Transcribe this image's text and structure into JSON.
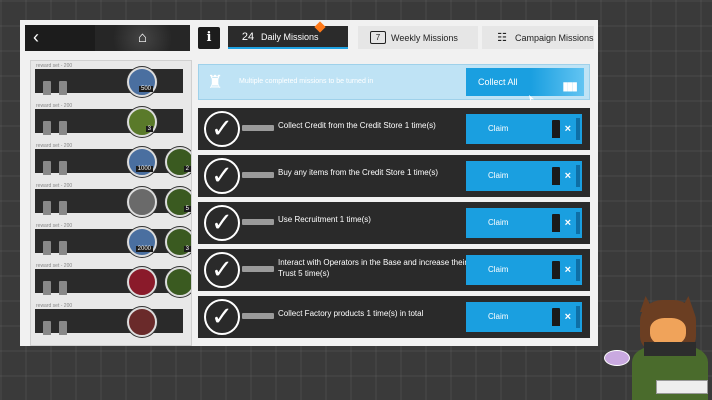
{
  "topbar": {
    "back_icon": "chevron-left-icon",
    "home_icon": "home-icon",
    "info_label": "i",
    "tabs": [
      {
        "label": "Daily Missions",
        "icon_text": "24",
        "active": true
      },
      {
        "label": "Weekly Missions",
        "icon_text": "7",
        "active": false
      },
      {
        "label": "Campaign Missions",
        "icon_text": "",
        "active": false
      }
    ]
  },
  "rewards": [
    {
      "label": "reward  set - 200",
      "items": [
        {
          "qty": "500"
        }
      ]
    },
    {
      "label": "reward  set - 200",
      "items": [
        {
          "qty": "3"
        }
      ]
    },
    {
      "label": "reward  set - 200",
      "items": [
        {
          "qty": "1000"
        },
        {
          "qty": "2"
        }
      ]
    },
    {
      "label": "reward  set - 200",
      "items": [
        {
          "qty": ""
        },
        {
          "qty": "5"
        }
      ]
    },
    {
      "label": "reward  set - 200",
      "items": [
        {
          "qty": "2000"
        },
        {
          "qty": "3"
        }
      ]
    },
    {
      "label": "reward  set - 200",
      "items": [
        {
          "qty": ""
        },
        {
          "qty": ""
        }
      ]
    },
    {
      "label": "reward  set - 200",
      "items": [
        {
          "qty": ""
        }
      ]
    }
  ],
  "banner": {
    "text": "Multiple completed missions to be turned in",
    "collect_label": "Collect All"
  },
  "missions": [
    {
      "text": "Collect Credit from the Credit Store 1 time(s)",
      "claim_label": "Claim"
    },
    {
      "text": "Buy any items from the Credit Store 1 time(s)",
      "claim_label": "Claim"
    },
    {
      "text": "Use Recruitment 1 time(s)",
      "claim_label": "Claim"
    },
    {
      "text": "Interact with Operators in the Base and increase their Trust 5 time(s)",
      "claim_label": "Claim"
    },
    {
      "text": "Collect Factory products 1 time(s) in total",
      "claim_label": "Claim"
    }
  ],
  "colors": {
    "accent": "#1a9fe0",
    "row_bg": "#2a2a2a",
    "badge": "#ff7a1a"
  }
}
